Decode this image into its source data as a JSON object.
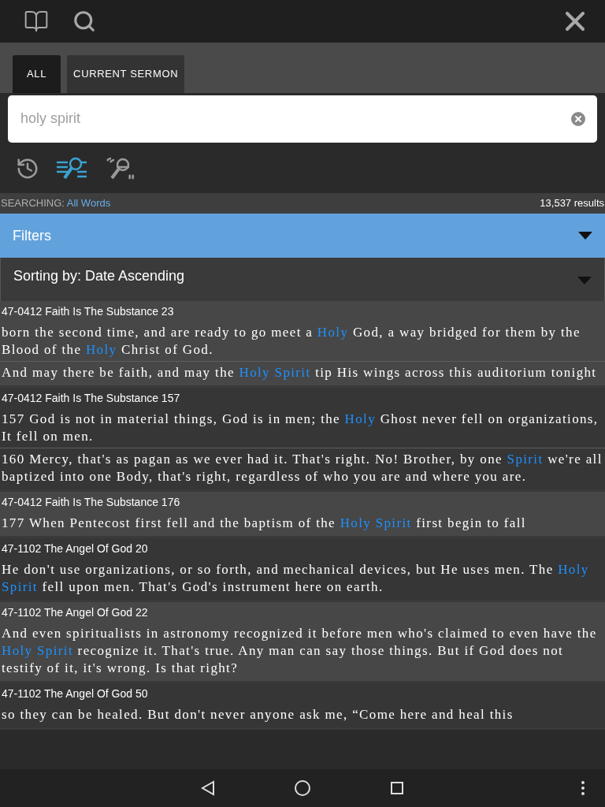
{
  "tabs": [
    {
      "label": "ALL",
      "selected": true
    },
    {
      "label": "CURRENT SERMON",
      "selected": false
    }
  ],
  "search": {
    "value": "holy spirit"
  },
  "modes": [
    {
      "kind": "history",
      "selected": false
    },
    {
      "kind": "words",
      "selected": true
    },
    {
      "kind": "phrase",
      "selected": false
    }
  ],
  "status": {
    "label": "SEARCHING:",
    "mode": "All Words",
    "count": "13,537 results"
  },
  "filters": {
    "label": "Filters",
    "expanded": false
  },
  "sorting": {
    "label": "Sorting by: Date Ascending"
  },
  "results": [
    {
      "header": "47-0412 Faith Is The Substance 23",
      "passages": [
        [
          {
            "text": "born the second time, and are ready to go meet a ",
            "highlight": false
          },
          {
            "text": "Holy",
            "highlight": true
          },
          {
            "text": " God, a way bridged for them by the Blood of the ",
            "highlight": false
          },
          {
            "text": "Holy",
            "highlight": true
          },
          {
            "text": " Christ of God.",
            "highlight": false
          }
        ],
        [
          {
            "text": "And may there be faith, and may the ",
            "highlight": false
          },
          {
            "text": "Holy Spirit",
            "highlight": true
          },
          {
            "text": " tip His wings across this auditorium tonight",
            "highlight": false
          }
        ]
      ]
    },
    {
      "header": "47-0412 Faith Is The Substance 157",
      "passages": [
        [
          {
            "text": "157 God is not in material things, God is in men; the ",
            "highlight": false
          },
          {
            "text": "Holy",
            "highlight": true
          },
          {
            "text": " Ghost never fell on organizations, It fell on men.",
            "highlight": false
          }
        ],
        [
          {
            "text": "160 Mercy, that's as pagan as we ever had it. That's right. No! Brother, by one ",
            "highlight": false
          },
          {
            "text": "Spirit",
            "highlight": true
          },
          {
            "text": " we're all baptized into one Body, that's right, regardless of who you are and where you are.",
            "highlight": false
          }
        ]
      ]
    },
    {
      "header": "47-0412 Faith Is The Substance 176",
      "passages": [
        [
          {
            "text": "177 When Pentecost first fell and the baptism of the ",
            "highlight": false
          },
          {
            "text": "Holy Spirit",
            "highlight": true
          },
          {
            "text": " first begin to fall",
            "highlight": false
          }
        ]
      ]
    },
    {
      "header": "47-1102 The Angel Of God 20",
      "passages": [
        [
          {
            "text": "He don't use organizations, or so forth, and mechanical devices, but He uses men. The ",
            "highlight": false
          },
          {
            "text": "Holy Spirit",
            "highlight": true
          },
          {
            "text": " fell upon men. That's God's instrument here on earth.",
            "highlight": false
          }
        ]
      ]
    },
    {
      "header": "47-1102 The Angel Of God 22",
      "passages": [
        [
          {
            "text": "And even spiritualists in astronomy recognized it before men who's claimed to even have the ",
            "highlight": false
          },
          {
            "text": "Holy Spirit",
            "highlight": true
          },
          {
            "text": " recognize it. That's true. Any man can say those things. But if God does not testify of it, it's wrong. Is that right?",
            "highlight": false
          }
        ]
      ]
    },
    {
      "header": "47-1102 The Angel Of God 50",
      "passages": [
        [
          {
            "text": "so they can be healed. But don't never anyone ask me, “Come here and heal this",
            "highlight": false
          }
        ]
      ]
    }
  ]
}
